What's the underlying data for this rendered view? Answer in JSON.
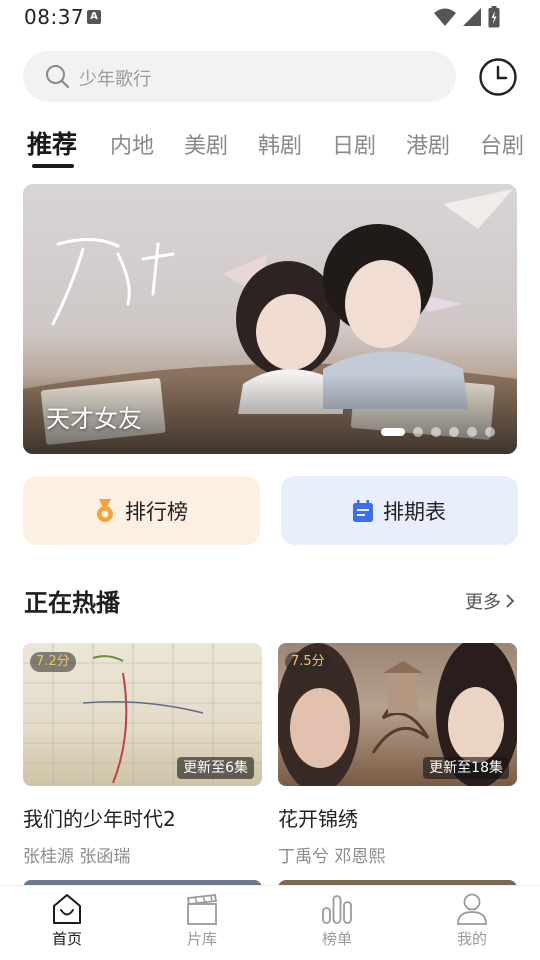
{
  "status_bar": {
    "time": "08:37",
    "notification_badge": "A"
  },
  "search": {
    "placeholder": "少年歌行"
  },
  "tabs": [
    {
      "label": "推荐",
      "active": true
    },
    {
      "label": "内地"
    },
    {
      "label": "美剧"
    },
    {
      "label": "韩剧"
    },
    {
      "label": "日剧"
    },
    {
      "label": "港剧"
    },
    {
      "label": "台剧"
    }
  ],
  "banner": {
    "title": "天才女友",
    "slide_count": 6,
    "active_slide": 1
  },
  "quick_actions": {
    "rank_label": "排行榜",
    "schedule_label": "排期表"
  },
  "section": {
    "title": "正在热播",
    "more_label": "更多"
  },
  "cards": [
    {
      "score": "7.2分",
      "update": "更新至6集",
      "title": "我们的少年时代2",
      "cast": "张桂源 张函瑞"
    },
    {
      "score": "7.5分",
      "update": "更新至18集",
      "title": "花开锦绣",
      "cast": "丁禹兮 邓恩熙"
    }
  ],
  "bottom_nav": [
    {
      "label": "首页",
      "icon": "home-icon",
      "active": true
    },
    {
      "label": "片库",
      "icon": "clapperboard-icon"
    },
    {
      "label": "榜单",
      "icon": "bar-chart-icon"
    },
    {
      "label": "我的",
      "icon": "person-icon"
    }
  ],
  "colors": {
    "rank_bg": "#fdf0e2",
    "schedule_bg": "#e8eefc",
    "medal": "#f3a33a",
    "calendar": "#3f6fe8",
    "score": "#f3c45a"
  }
}
